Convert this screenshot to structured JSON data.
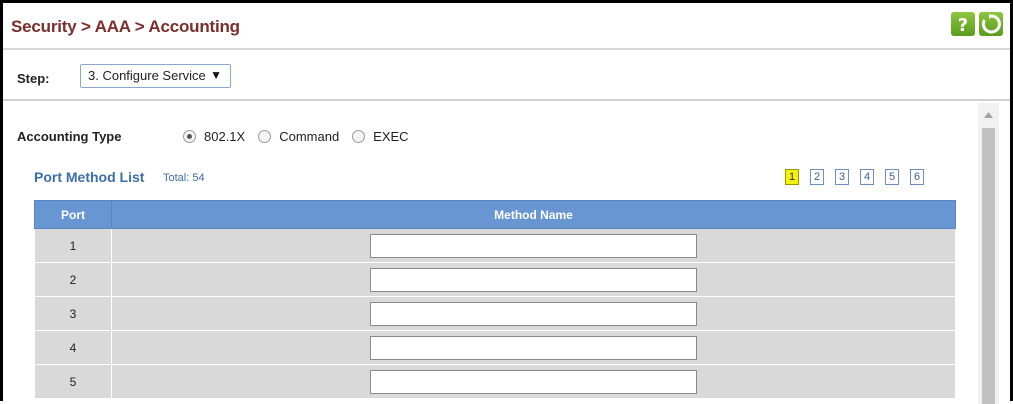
{
  "header": {
    "breadcrumb": "Security > AAA > Accounting",
    "help_icon": "help-icon",
    "refresh_icon": "refresh-icon"
  },
  "step": {
    "label": "Step:",
    "selected": "3. Configure Service"
  },
  "accounting_type": {
    "label": "Accounting Type",
    "options": [
      "802.1X",
      "Command",
      "EXEC"
    ],
    "selected": "802.1X"
  },
  "port_method_list": {
    "title": "Port Method List",
    "total": "Total: 54",
    "pages": [
      "1",
      "2",
      "3",
      "4",
      "5",
      "6"
    ],
    "current_page": "1",
    "columns": [
      "Port",
      "Method Name"
    ],
    "rows": [
      {
        "port": "1",
        "method_name": ""
      },
      {
        "port": "2",
        "method_name": ""
      },
      {
        "port": "3",
        "method_name": ""
      },
      {
        "port": "4",
        "method_name": ""
      },
      {
        "port": "5",
        "method_name": ""
      }
    ]
  },
  "colors": {
    "breadcrumb": "#7a2e2e",
    "accent_blue": "#3c6fa8",
    "table_header": "#6896d2",
    "row_bg": "#d9d9d9",
    "active_page": "#f4f20a",
    "icon_green": "#6aad2a"
  }
}
